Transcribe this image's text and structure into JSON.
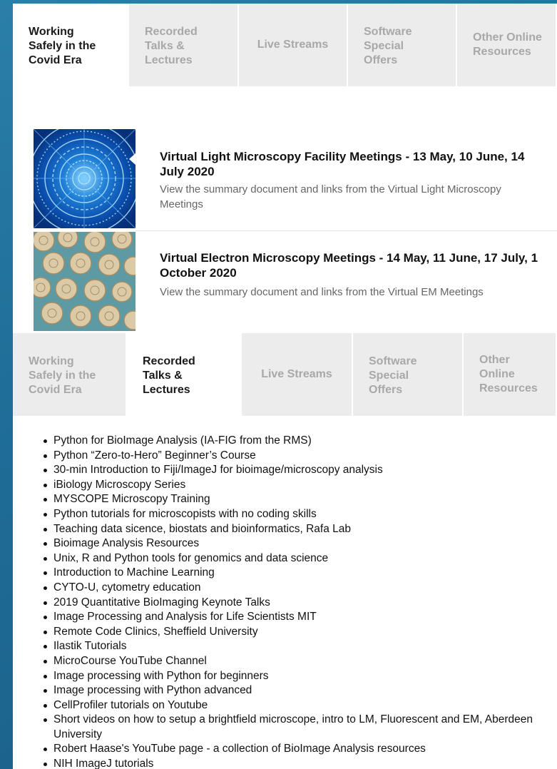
{
  "tabs_top": [
    {
      "lines": [
        "Working",
        "Safely in the",
        "Covid Era"
      ],
      "active": true
    },
    {
      "lines": [
        "Recorded",
        "Talks &",
        "Lectures"
      ],
      "active": false
    },
    {
      "lines": [
        "Live Streams"
      ],
      "active": false
    },
    {
      "lines": [
        "Software",
        "Special",
        "Offers"
      ],
      "active": false
    },
    {
      "lines": [
        "Other Online",
        "Resources"
      ],
      "active": false
    }
  ],
  "articles": [
    {
      "title": "Virtual Light Microscopy Facility Meetings - 13 May, 10 June, 14 July 2020",
      "summary": "View the summary document and links from the Virtual Light Microscopy Meetings",
      "thumb_icon": "blue-mandala-image"
    },
    {
      "title": "Virtual Electron Microscopy Meetings - 14 May, 11 June, 17 July, 1 October 2020",
      "summary": "View the summary document and links from the Virtual EM Meetings",
      "thumb_icon": "diatom-cells-image"
    }
  ],
  "tabs_bottom": [
    {
      "lines": [
        "Working",
        "Safely in the",
        "Covid Era"
      ],
      "active": false
    },
    {
      "lines": [
        "Recorded",
        "Talks &",
        "Lectures"
      ],
      "active": true
    },
    {
      "lines": [
        "Live Streams"
      ],
      "active": false
    },
    {
      "lines": [
        "Software",
        "Special",
        "Offers"
      ],
      "active": false
    },
    {
      "lines": [
        "Other Online",
        "Resources"
      ],
      "active": false
    }
  ],
  "resources": [
    "Python for BioImage Analysis (IA-FIG from the RMS)",
    "Python “Zero-to-Hero” Beginner’s Course",
    "30-min Introduction to Fiji/ImageJ for bioimage/microscopy analysis",
    "iBiology Microscopy Series",
    "MYSCOPE Microscopy Training",
    "Python tutorials for microscopists with no coding skills",
    "Teaching data sicence, biostats and bioinformatics, Rafa Lab",
    "Bioimage Analysis Resources",
    "Unix, R and Python tools for genomics and data science",
    "Introduction to Machine Learning",
    "CYTO-U, cytometry education",
    "2019 Quantitative BioImaging Keynote Talks",
    "Image Processing and Analysis for Life Scientists MIT",
    "Remote Code Clinics, Sheffield University",
    "Ilastik Tutorials",
    "MicroCourse YouTube Channel",
    "Image processing with Python for beginners",
    "Image processing with Python advanced",
    "CellProfiler tutorials on Youtube",
    "Short videos on how to setup a brightfield microscope, intro to LM, Fluorescent and EM, Aberdeen University",
    "Robert Haase's YouTube page - a collection of BioImage Analysis resources",
    "NIH ImageJ tutorials"
  ],
  "colors": {
    "background": "#1f6e99",
    "panel": "#ffffff",
    "tab_inactive_bg": "#ececec",
    "tab_inactive_text": "#a8a8a8",
    "text_primary": "#111111",
    "text_secondary": "#666666"
  }
}
